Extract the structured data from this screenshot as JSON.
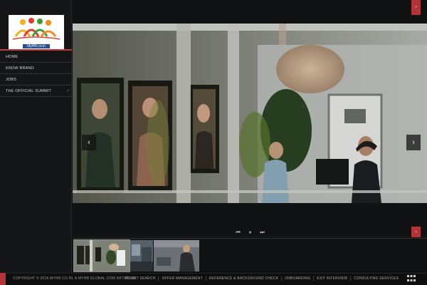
{
  "brand": {
    "logo_text": "MyHR.co.in"
  },
  "nav": {
    "items": [
      {
        "label": "HOME"
      },
      {
        "label": "KNOW BRAND"
      },
      {
        "label": "JOBS"
      },
      {
        "label": "THE OFFICIAL SUMMIT",
        "has_submenu": true
      }
    ]
  },
  "slideshow": {
    "prev_icon": "chevron-left-icon",
    "next_icon": "chevron-right-icon",
    "controls": [
      "previous-icon",
      "pause-icon",
      "next-icon"
    ],
    "thumbnail_count": 3,
    "active_thumbnail": 1
  },
  "footer": {
    "copyright": "COPYRIGHT © 2016.MYHR.CO.IN, A MYHR GLOBAL.COM INITIATIVE",
    "links": [
      "TALENT SEARCH",
      "OFFER MANAGEMENT",
      "REFERENCE & BACKGROUND CHECK",
      "ONBOARDING",
      "EXIT INTERVIEW",
      "CONSULTING SERVICES"
    ]
  },
  "colors": {
    "accent": "#b23436",
    "background": "#111213",
    "sidebar": "#151617"
  }
}
